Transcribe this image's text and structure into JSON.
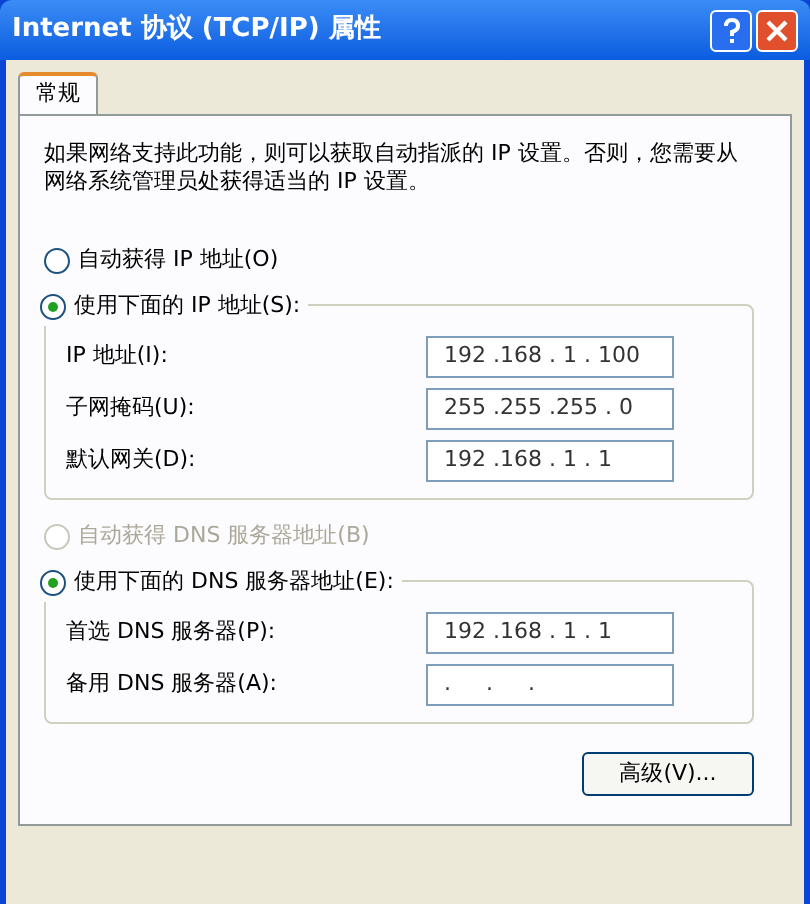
{
  "window": {
    "title": "Internet 协议 (TCP/IP) 属性"
  },
  "tabs": [
    {
      "label": "常规",
      "selected": true
    }
  ],
  "description": "如果网络支持此功能，则可以获取自动指派的 IP 设置。否则，您需要从网络系统管理员处获得适当的 IP 设置。",
  "ip_mode": [
    {
      "label": "自动获得 IP 地址(O)",
      "selected": false,
      "disabled": false
    },
    {
      "label": "使用下面的 IP 地址(S):",
      "selected": true,
      "disabled": false
    }
  ],
  "ip_fields": [
    {
      "label": "IP 地址(I):",
      "value": "192 .168 . 1 . 100"
    },
    {
      "label": "子网掩码(U):",
      "value": "255 .255 .255 . 0"
    },
    {
      "label": "默认网关(D):",
      "value": "192 .168 . 1 . 1"
    }
  ],
  "dns_mode": [
    {
      "label": "自动获得 DNS 服务器地址(B)",
      "selected": false,
      "disabled": true
    },
    {
      "label": "使用下面的 DNS 服务器地址(E):",
      "selected": true,
      "disabled": false
    }
  ],
  "dns_fields": [
    {
      "label": "首选 DNS 服务器(P):",
      "value": "192 .168 . 1 . 1"
    },
    {
      "label": "备用 DNS 服务器(A):",
      "value": ".     .     ."
    }
  ],
  "buttons": [
    "高级(V)..."
  ]
}
